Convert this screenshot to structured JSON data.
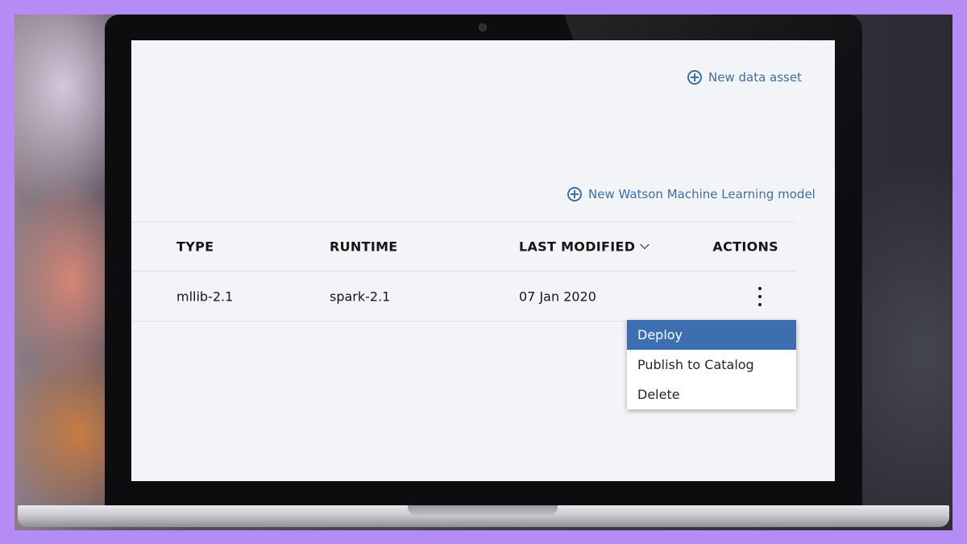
{
  "toolbar": {
    "new_data_asset": "New data asset",
    "new_wml_model": "New Watson Machine Learning model"
  },
  "table": {
    "headers": {
      "type": "TYPE",
      "runtime": "RUNTIME",
      "last_modified": "LAST MODIFIED",
      "actions": "ACTIONS"
    },
    "rows": [
      {
        "type": "mllib-2.1",
        "runtime": "spark-2.1",
        "last_modified": "07 Jan 2020"
      }
    ]
  },
  "overflow_menu": {
    "items": [
      {
        "label": "Deploy",
        "active": true
      },
      {
        "label": "Publish to Catalog",
        "active": false
      },
      {
        "label": "Delete",
        "active": false
      }
    ]
  },
  "colors": {
    "background": "#b58cf6",
    "accent": "#3c6fa8",
    "menu_highlight": "#3d6fb0",
    "screen_bg": "#f3f4f8"
  }
}
